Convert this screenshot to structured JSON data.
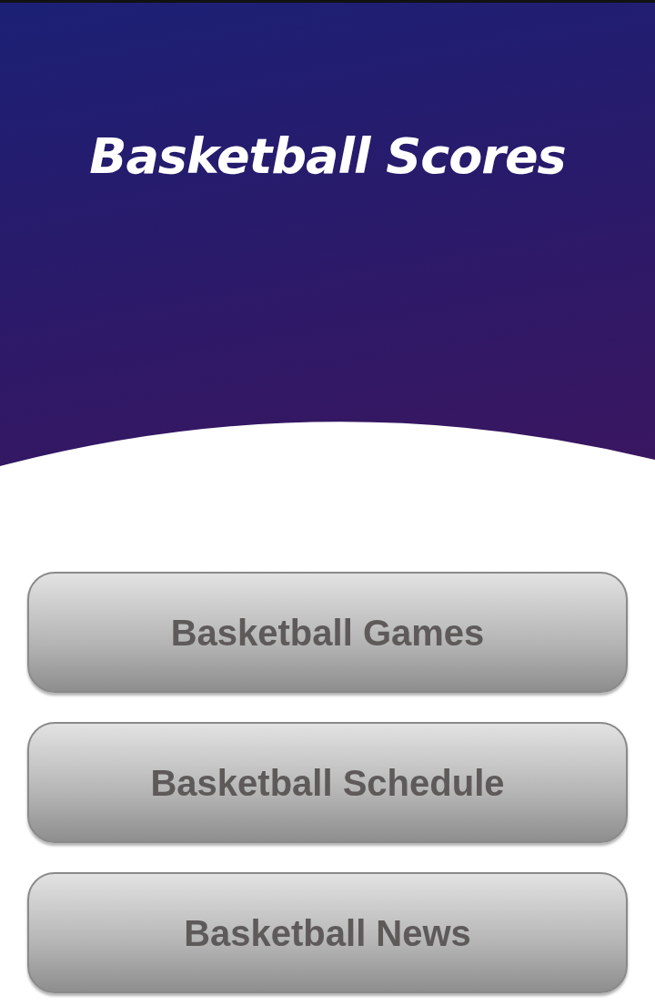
{
  "header": {
    "title": "Basketball Scores"
  },
  "buttons": [
    {
      "label": "Basketball Games"
    },
    {
      "label": "Basketball Schedule"
    },
    {
      "label": "Basketball News"
    }
  ]
}
